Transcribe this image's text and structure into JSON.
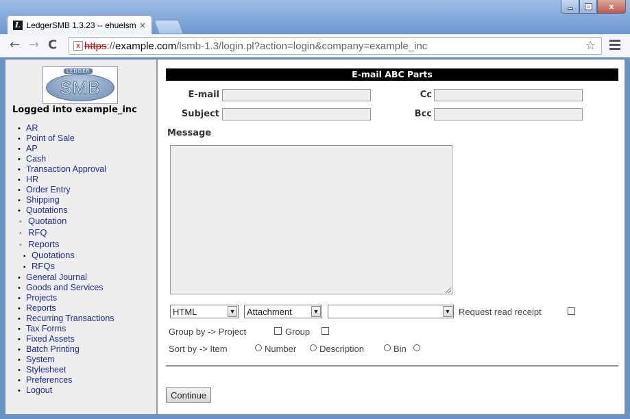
{
  "browser": {
    "tab_title": "LedgerSMB 1.3.23 -- ehuelsm",
    "tab_close": "×",
    "url_scheme": "https",
    "url_sep": "://",
    "url_host": "example.com",
    "url_path": "/lsmb-1.3/login.pl?action=login&company=example_inc",
    "window_close": "x"
  },
  "sidebar": {
    "logo_top": "LEDGER",
    "logo_text": "SMB",
    "logged_in": "Logged into example_inc",
    "items": [
      {
        "label": "AR",
        "level": 0
      },
      {
        "label": "Point of Sale",
        "level": 0
      },
      {
        "label": "AP",
        "level": 0
      },
      {
        "label": "Cash",
        "level": 0
      },
      {
        "label": "Transaction Approval",
        "level": 0
      },
      {
        "label": "HR",
        "level": 0
      },
      {
        "label": "Order Entry",
        "level": 0
      },
      {
        "label": "Shipping",
        "level": 0
      },
      {
        "label": "Quotations",
        "level": 0
      },
      {
        "label": "Quotation",
        "level": 1
      },
      {
        "label": "RFQ",
        "level": 1
      },
      {
        "label": "Reports",
        "level": 1
      },
      {
        "label": "Quotations",
        "level": 2
      },
      {
        "label": "RFQs",
        "level": 2
      },
      {
        "label": "General Journal",
        "level": 0
      },
      {
        "label": "Goods and Services",
        "level": 0
      },
      {
        "label": "Projects",
        "level": 0
      },
      {
        "label": "Reports",
        "level": 0
      },
      {
        "label": "Recurring Transactions",
        "level": 0
      },
      {
        "label": "Tax Forms",
        "level": 0
      },
      {
        "label": "Fixed Assets",
        "level": 0
      },
      {
        "label": "Batch Printing",
        "level": 0
      },
      {
        "label": "System",
        "level": 0
      },
      {
        "label": "Stylesheet",
        "level": 0
      },
      {
        "label": "Preferences",
        "level": 0
      },
      {
        "label": "Logout",
        "level": 0
      }
    ]
  },
  "form": {
    "header": "E-mail ABC Parts",
    "email_label": "E-mail",
    "email_value": "",
    "cc_label": "Cc",
    "cc_value": "",
    "subject_label": "Subject",
    "subject_value": "",
    "bcc_label": "Bcc",
    "bcc_value": "",
    "message_label": "Message",
    "message_value": "",
    "format_select": "HTML",
    "attachment_select": "Attachment",
    "language_select": "",
    "read_receipt_label": "Request read receipt",
    "group_by_label": "Group by -> Project",
    "group_label": "Group",
    "sort_by_label": "Sort by -> Item",
    "sort_number": "Number",
    "sort_description": "Description",
    "sort_bin": "Bin",
    "continue_label": "Continue"
  }
}
